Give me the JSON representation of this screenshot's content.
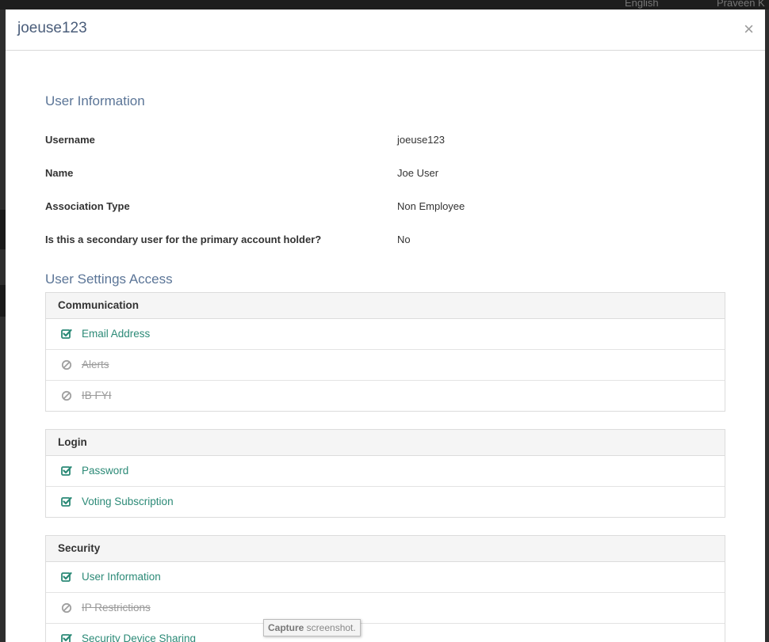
{
  "background": {
    "language": "English",
    "user": "Praveen K"
  },
  "modal": {
    "title": "joeuse123",
    "close_glyph": "×"
  },
  "user_information": {
    "heading": "User Information",
    "rows": [
      {
        "label": "Username",
        "value": "joeuse123"
      },
      {
        "label": "Name",
        "value": "Joe User"
      },
      {
        "label": "Association Type",
        "value": "Non Employee"
      },
      {
        "label": "Is this a secondary user for the primary account holder?",
        "value": "No"
      }
    ]
  },
  "user_settings_access": {
    "heading": "User Settings Access",
    "panels": [
      {
        "title": "Communication",
        "items": [
          {
            "label": "Email Address",
            "enabled": true,
            "icon": "check-square-icon"
          },
          {
            "label": "Alerts",
            "enabled": false,
            "icon": "ban-icon"
          },
          {
            "label": "IB FYI",
            "enabled": false,
            "icon": "ban-icon"
          }
        ]
      },
      {
        "title": "Login",
        "items": [
          {
            "label": "Password",
            "enabled": true,
            "icon": "check-square-icon"
          },
          {
            "label": "Voting Subscription",
            "enabled": true,
            "icon": "check-square-icon"
          }
        ]
      },
      {
        "title": "Security",
        "items": [
          {
            "label": "User Information",
            "enabled": true,
            "icon": "check-square-icon"
          },
          {
            "label": "IP Restrictions",
            "enabled": false,
            "icon": "ban-icon"
          },
          {
            "label": "Security Device Sharing",
            "enabled": true,
            "icon": "check-square-icon"
          }
        ]
      }
    ]
  },
  "tooltip": {
    "bold": "Capture",
    "rest": " screenshot."
  },
  "colors": {
    "enabled_text": "#2c8a77",
    "disabled_text": "#9a9a9a",
    "heading": "#5b7597"
  }
}
